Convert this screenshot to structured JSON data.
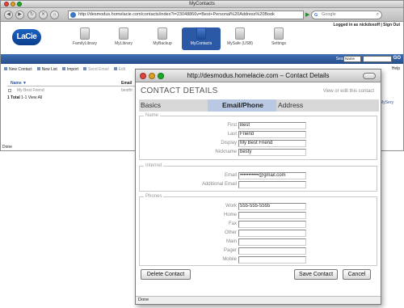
{
  "browser": {
    "title": "MyContacts",
    "url": "http://desmodus.homelacie.com/contacts/index?i=23048866v=Best+Personal%20Address%20Book",
    "search_placeholder": "Google"
  },
  "header": {
    "logged_in_text": "Logged in as nickdosoff  |  Sign Out",
    "logo": "LaCie",
    "nav": [
      "FamilyLibrary",
      "MyLibrary",
      "MyBackup",
      "MyContacts",
      "MySafe (USB)",
      "Settings"
    ],
    "search_label": "Search:",
    "search_select": "Name",
    "go": "GO"
  },
  "contacts_toolbar": {
    "buttons": [
      "New Contact",
      "New List",
      "Import",
      "Send Email",
      "Edit"
    ],
    "help": "Help"
  },
  "contacts_list": {
    "col_name": "Name ▼",
    "col_email": "Email",
    "row_name": "My Best Friend",
    "row_email": "bestfri",
    "total": "1 Total",
    "total_suffix": "1-1 View All",
    "side_link": "MySery"
  },
  "main_status": "Done",
  "popup": {
    "title": "http://desmodus.homelacie.com – Contact Details",
    "heading": "CONTACT DETAILS",
    "heading_hint": "View or edit this contact",
    "tabs": [
      "Basics",
      "Email/Phone",
      "Address"
    ],
    "active_tab": "Email/Phone",
    "sections": {
      "name": {
        "legend": "Name",
        "fields": [
          {
            "label": "First",
            "value": "Best"
          },
          {
            "label": "Last",
            "value": "Friend"
          },
          {
            "label": "Display",
            "value": "My Best Friend"
          },
          {
            "label": "Nickname",
            "value": "besty"
          }
        ]
      },
      "internet": {
        "legend": "Internet",
        "fields": [
          {
            "label": "Email",
            "value": "•••••••••••@gmail.com"
          },
          {
            "label": "Additional Email",
            "value": ""
          }
        ]
      },
      "phones": {
        "legend": "Phones",
        "fields": [
          {
            "label": "Work",
            "value": "555-555-5555"
          },
          {
            "label": "Home",
            "value": ""
          },
          {
            "label": "Fax",
            "value": ""
          },
          {
            "label": "Other",
            "value": ""
          },
          {
            "label": "Main",
            "value": ""
          },
          {
            "label": "Pager",
            "value": ""
          },
          {
            "label": "Mobile",
            "value": ""
          }
        ]
      }
    },
    "buttons": {
      "delete": "Delete Contact",
      "save": "Save Contact",
      "cancel": "Cancel"
    },
    "status": "Done"
  },
  "colors": {
    "accent_blue": "#2b59a6",
    "tab_active": "#b9c9e3"
  }
}
